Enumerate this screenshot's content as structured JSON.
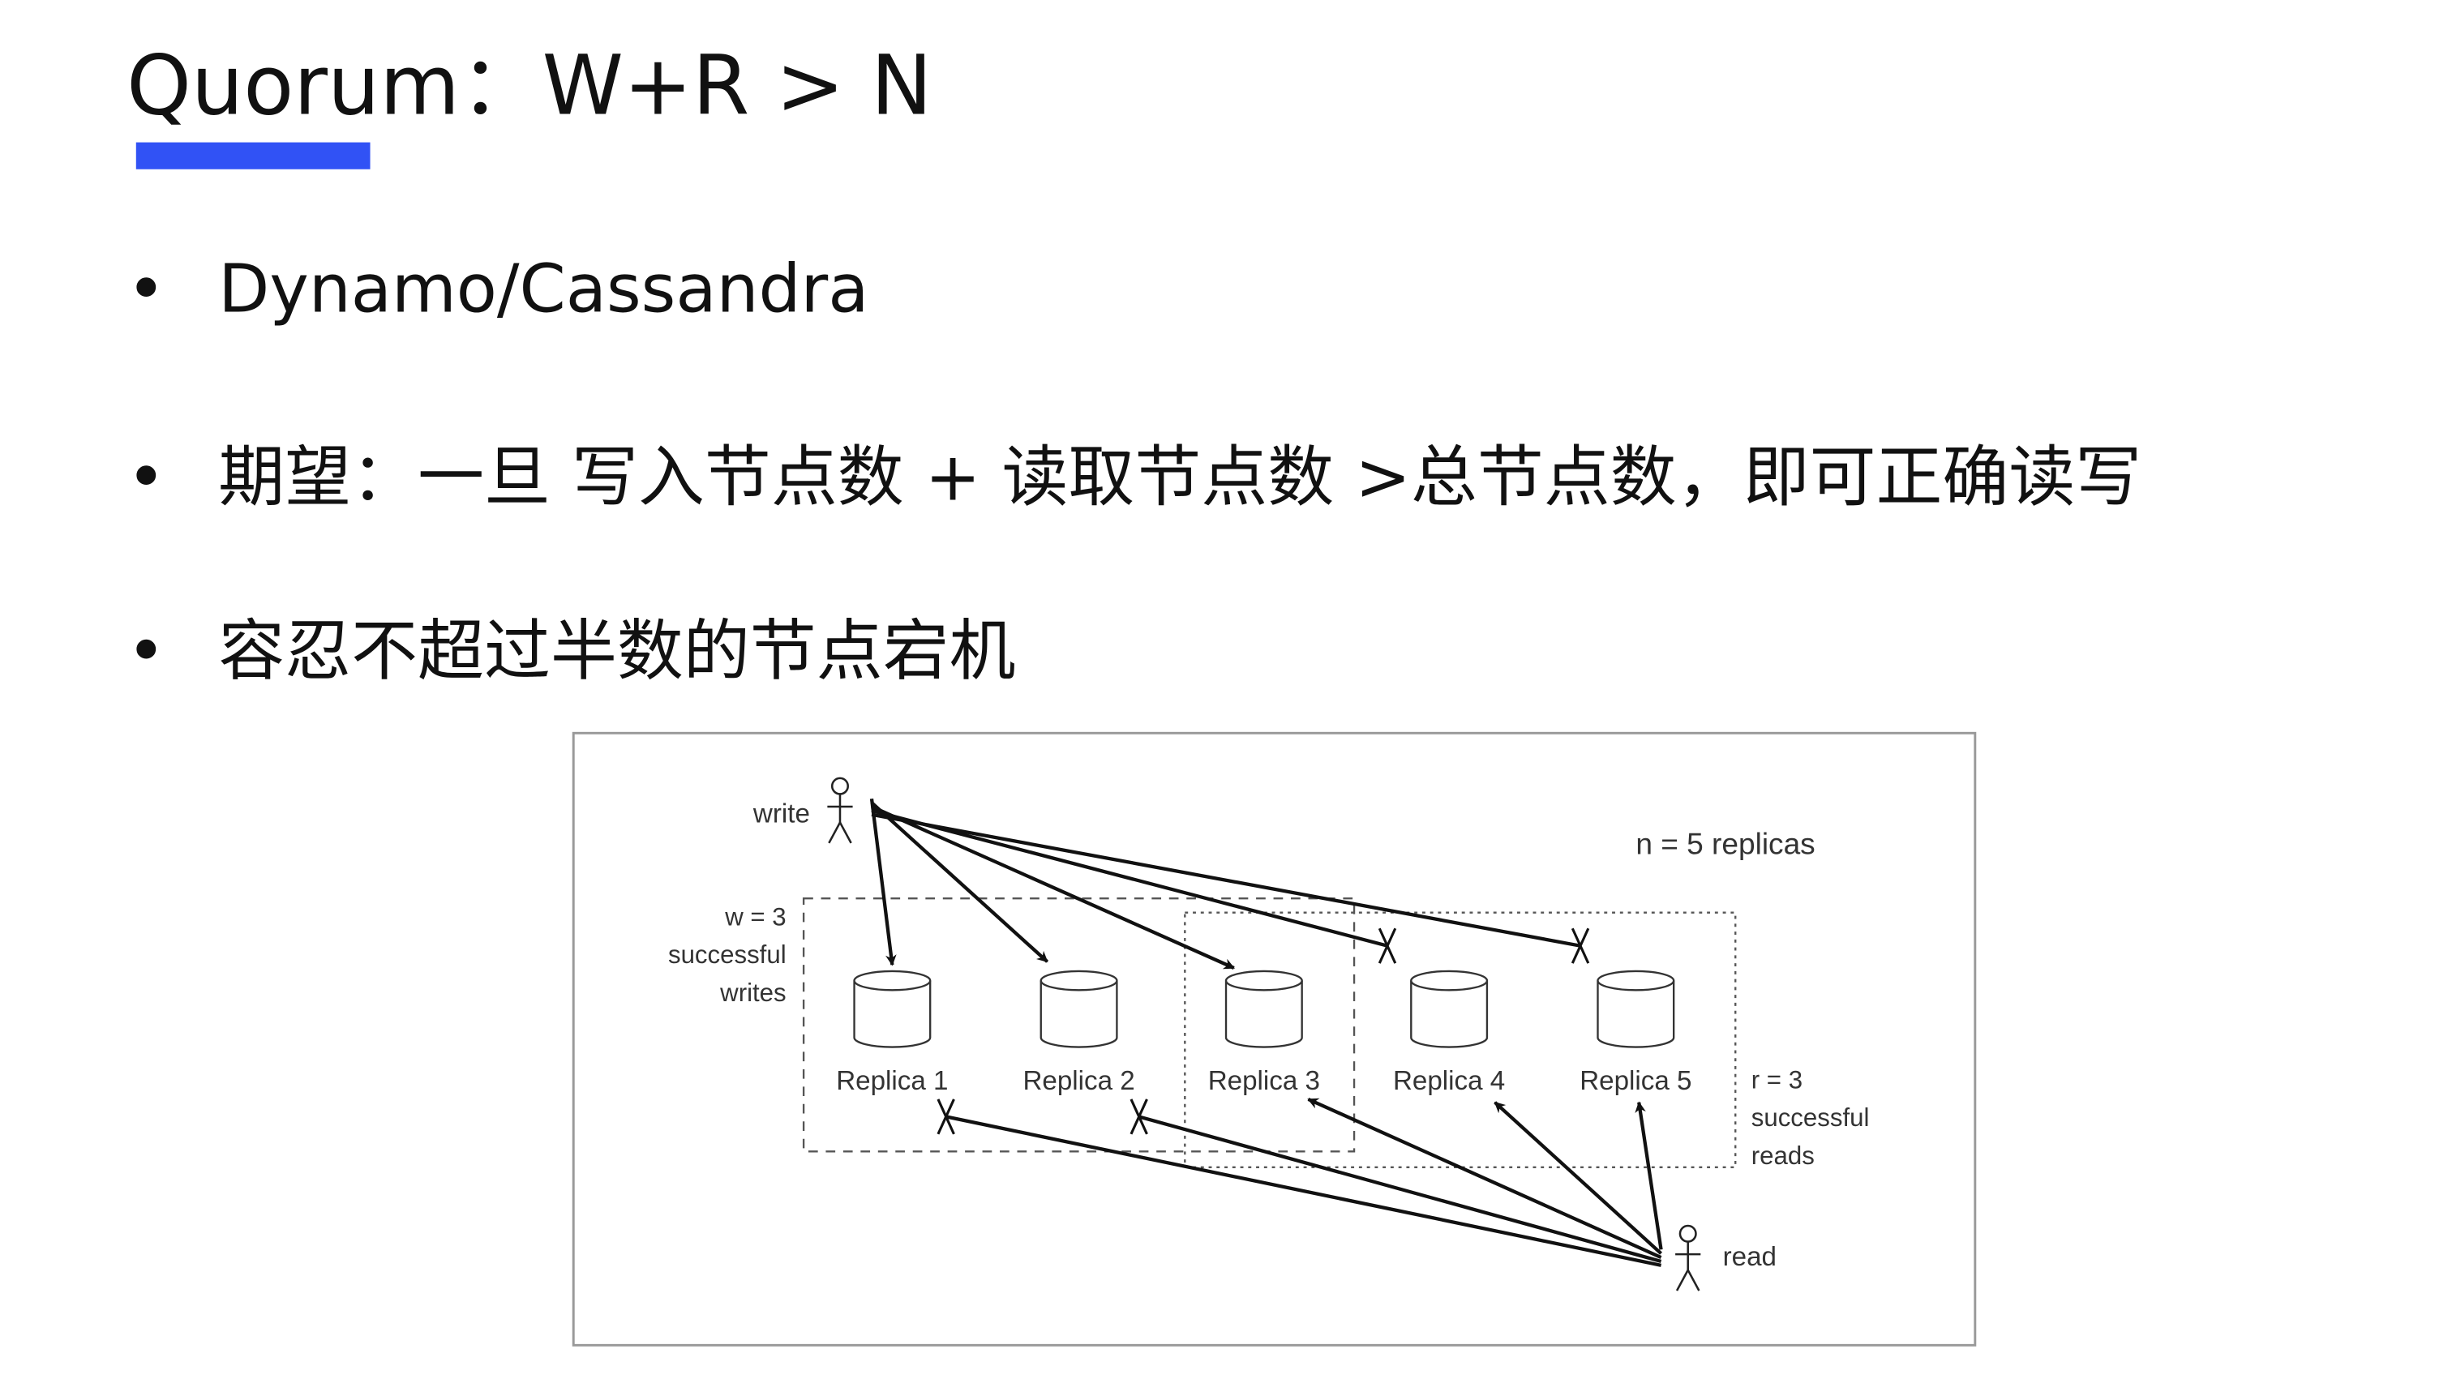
{
  "title": "Quorum：W+R > N",
  "accent_color": "#3152f5",
  "bullets": [
    "Dynamo/Cassandra",
    "期望：一旦 写入节点数 + 读取节点数 >总节点数，即可正确读写",
    "容忍不超过半数的节点宕机"
  ],
  "bullet_symbol": "•",
  "diagram": {
    "write_label": "write",
    "read_label": "read",
    "n_label": "n = 5 replicas",
    "w_label": [
      "w = 3",
      "successful",
      "writes"
    ],
    "r_label": [
      "r = 3",
      "successful",
      "reads"
    ],
    "replicas": [
      "Replica 1",
      "Replica 2",
      "Replica 3",
      "Replica 4",
      "Replica 5"
    ],
    "write_success": [
      true,
      true,
      true,
      false,
      false
    ],
    "read_success": [
      false,
      false,
      true,
      true,
      true
    ]
  }
}
